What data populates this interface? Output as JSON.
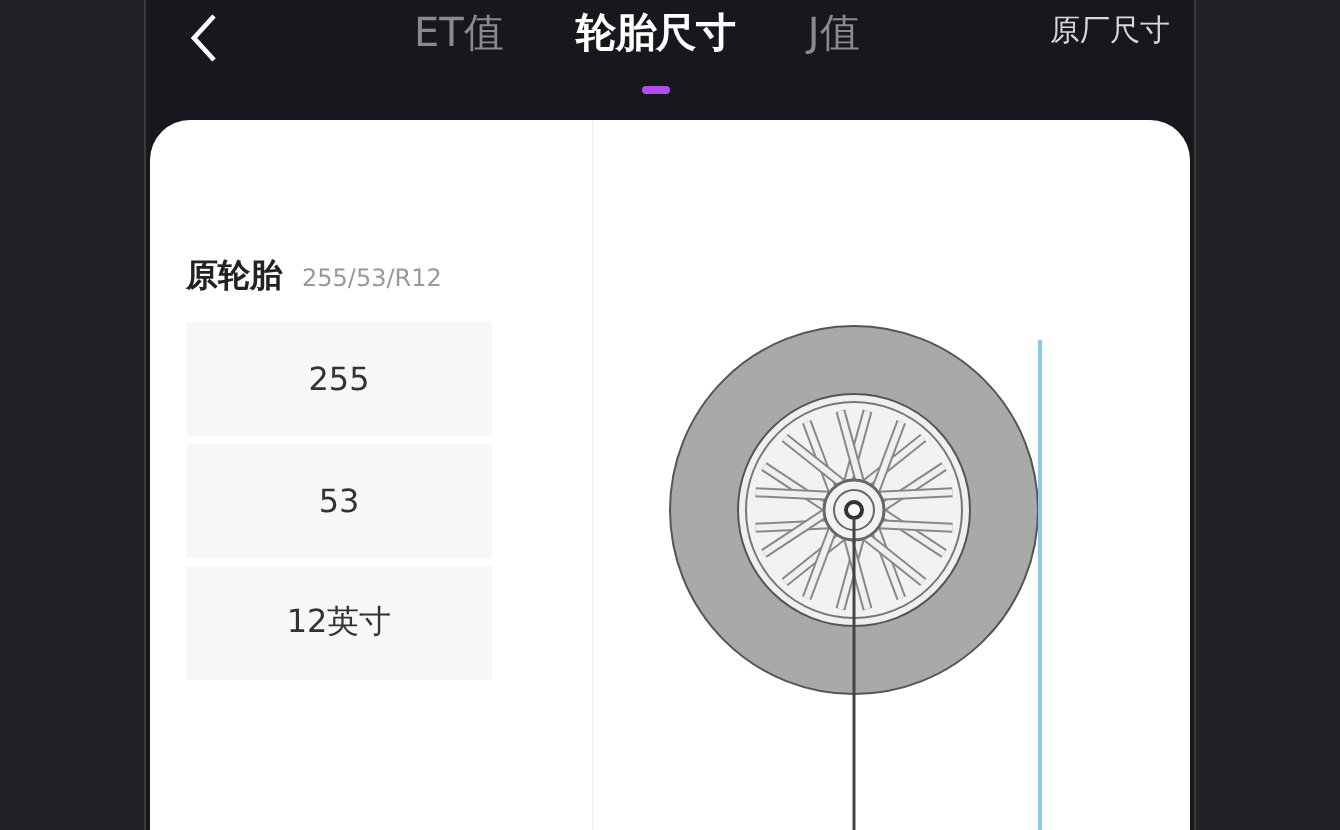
{
  "header": {
    "tabs": [
      {
        "label": "ET值",
        "selected": false
      },
      {
        "label": "轮胎尺寸",
        "selected": true
      },
      {
        "label": "J值",
        "selected": false
      }
    ],
    "action": "原厂尺寸"
  },
  "original_tire": {
    "title": "原轮胎",
    "spec": "255/53/R12",
    "fields": [
      "255",
      "53",
      "12英寸"
    ]
  }
}
